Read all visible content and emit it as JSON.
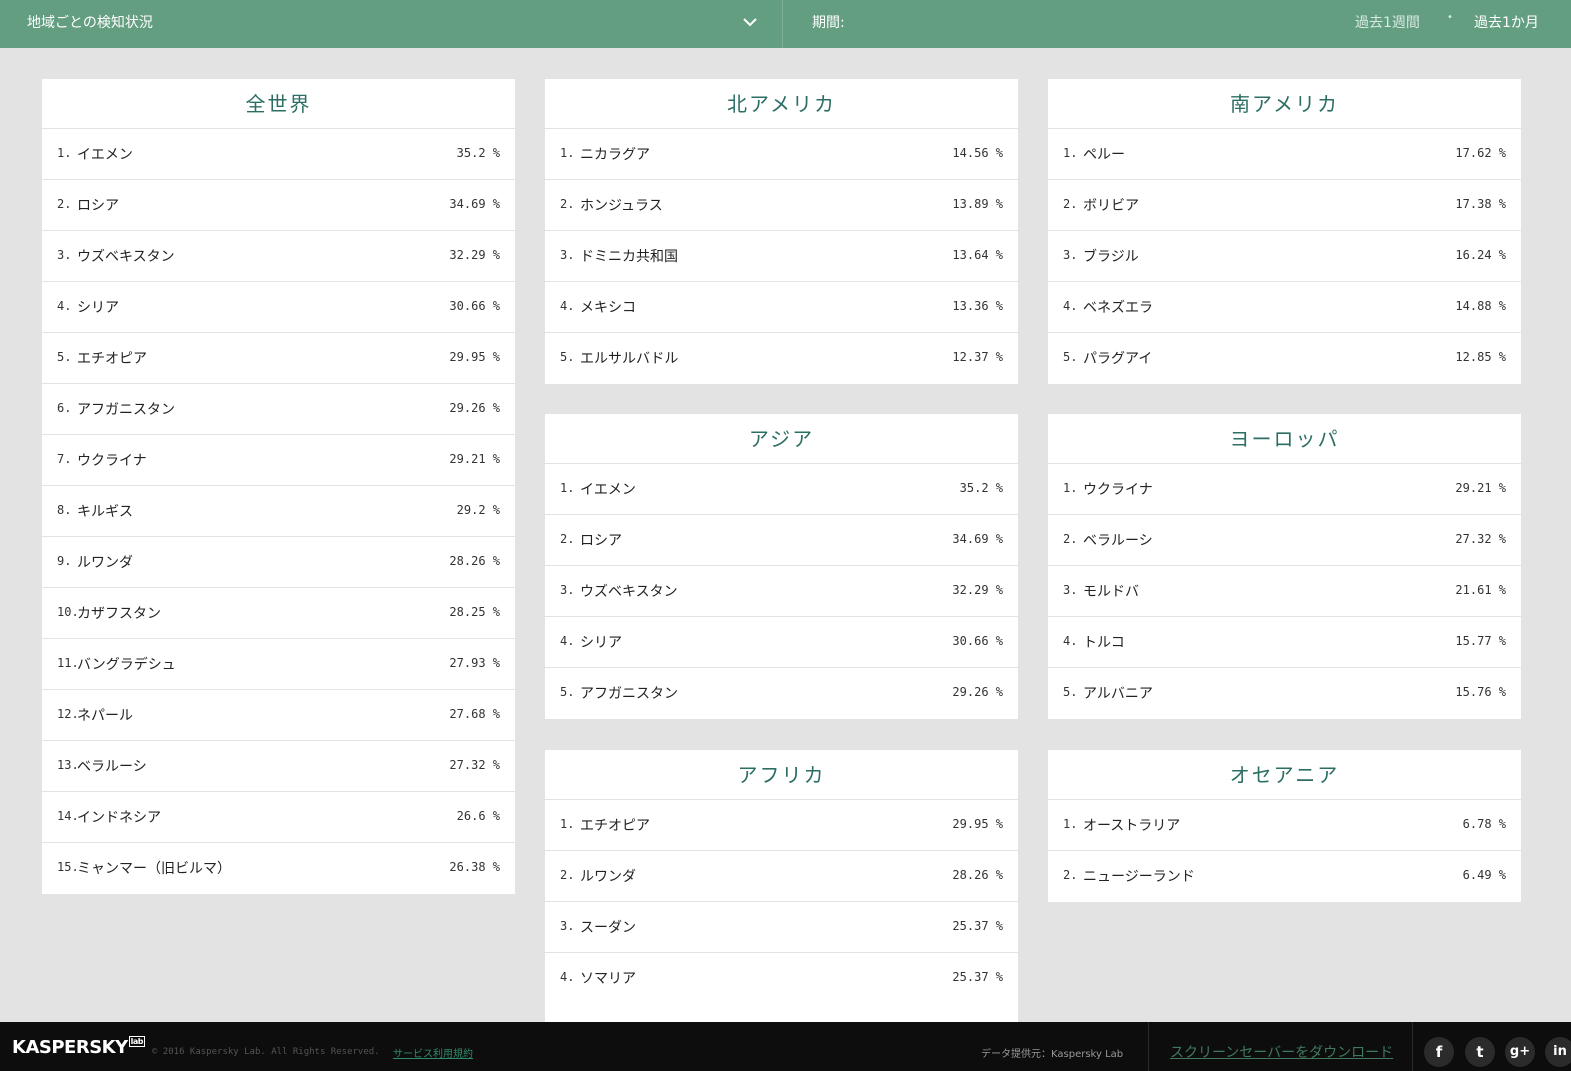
{
  "header": {
    "region_label": "地域ごとの検知状況",
    "period_label": "期間:",
    "period_week": "過去1週間",
    "period_dot": "•",
    "period_month": "過去1か月"
  },
  "cards": {
    "world": {
      "title": "全世界",
      "rows": [
        {
          "rank": "1.",
          "name": "イエメン",
          "pct": "35.2 %"
        },
        {
          "rank": "2.",
          "name": "ロシア",
          "pct": "34.69 %"
        },
        {
          "rank": "3.",
          "name": "ウズベキスタン",
          "pct": "32.29 %"
        },
        {
          "rank": "4.",
          "name": "シリア",
          "pct": "30.66 %"
        },
        {
          "rank": "5.",
          "name": "エチオピア",
          "pct": "29.95 %"
        },
        {
          "rank": "6.",
          "name": "アフガニスタン",
          "pct": "29.26 %"
        },
        {
          "rank": "7.",
          "name": "ウクライナ",
          "pct": "29.21 %"
        },
        {
          "rank": "8.",
          "name": "キルギス",
          "pct": "29.2 %"
        },
        {
          "rank": "9.",
          "name": "ルワンダ",
          "pct": "28.26 %"
        },
        {
          "rank": "10.",
          "name": "カザフスタン",
          "pct": "28.25 %"
        },
        {
          "rank": "11.",
          "name": "バングラデシュ",
          "pct": "27.93 %"
        },
        {
          "rank": "12.",
          "name": "ネパール",
          "pct": "27.68 %"
        },
        {
          "rank": "13.",
          "name": "ベラルーシ",
          "pct": "27.32 %"
        },
        {
          "rank": "14.",
          "name": "インドネシア",
          "pct": "26.6 %"
        },
        {
          "rank": "15.",
          "name": "ミャンマー（旧ビルマ）",
          "pct": "26.38 %"
        }
      ]
    },
    "north_america": {
      "title": "北アメリカ",
      "rows": [
        {
          "rank": "1.",
          "name": "ニカラグア",
          "pct": "14.56 %"
        },
        {
          "rank": "2.",
          "name": "ホンジュラス",
          "pct": "13.89 %"
        },
        {
          "rank": "3.",
          "name": "ドミニカ共和国",
          "pct": "13.64 %"
        },
        {
          "rank": "4.",
          "name": "メキシコ",
          "pct": "13.36 %"
        },
        {
          "rank": "5.",
          "name": "エルサルバドル",
          "pct": "12.37 %"
        }
      ]
    },
    "south_america": {
      "title": "南アメリカ",
      "rows": [
        {
          "rank": "1.",
          "name": "ペルー",
          "pct": "17.62 %"
        },
        {
          "rank": "2.",
          "name": "ボリビア",
          "pct": "17.38 %"
        },
        {
          "rank": "3.",
          "name": "ブラジル",
          "pct": "16.24 %"
        },
        {
          "rank": "4.",
          "name": "ベネズエラ",
          "pct": "14.88 %"
        },
        {
          "rank": "5.",
          "name": "パラグアイ",
          "pct": "12.85 %"
        }
      ]
    },
    "asia": {
      "title": "アジア",
      "rows": [
        {
          "rank": "1.",
          "name": "イエメン",
          "pct": "35.2 %"
        },
        {
          "rank": "2.",
          "name": "ロシア",
          "pct": "34.69 %"
        },
        {
          "rank": "3.",
          "name": "ウズベキスタン",
          "pct": "32.29 %"
        },
        {
          "rank": "4.",
          "name": "シリア",
          "pct": "30.66 %"
        },
        {
          "rank": "5.",
          "name": "アフガニスタン",
          "pct": "29.26 %"
        }
      ]
    },
    "europe": {
      "title": "ヨーロッパ",
      "rows": [
        {
          "rank": "1.",
          "name": "ウクライナ",
          "pct": "29.21 %"
        },
        {
          "rank": "2.",
          "name": "ベラルーシ",
          "pct": "27.32 %"
        },
        {
          "rank": "3.",
          "name": "モルドバ",
          "pct": "21.61 %"
        },
        {
          "rank": "4.",
          "name": "トルコ",
          "pct": "15.77 %"
        },
        {
          "rank": "5.",
          "name": "アルバニア",
          "pct": "15.76 %"
        }
      ]
    },
    "africa": {
      "title": "アフリカ",
      "rows": [
        {
          "rank": "1.",
          "name": "エチオピア",
          "pct": "29.95 %"
        },
        {
          "rank": "2.",
          "name": "ルワンダ",
          "pct": "28.26 %"
        },
        {
          "rank": "3.",
          "name": "スーダン",
          "pct": "25.37 %"
        },
        {
          "rank": "4.",
          "name": "ソマリア",
          "pct": "25.37 %"
        }
      ]
    },
    "oceania": {
      "title": "オセアニア",
      "rows": [
        {
          "rank": "1.",
          "name": "オーストラリア",
          "pct": "6.78 %"
        },
        {
          "rank": "2.",
          "name": "ニュージーランド",
          "pct": "6.49 %"
        }
      ]
    }
  },
  "footer": {
    "logo": "KASPERSKY",
    "logo_badge": "lab",
    "copyright": "© 2016 Kaspersky Lab. All Rights Reserved.",
    "terms": "サービス利用規約",
    "source": "データ提供元：Kaspersky Lab",
    "screensaver": "スクリーンセーバーをダウンロード",
    "social": [
      {
        "icon": "facebook-icon",
        "glyph": "f"
      },
      {
        "icon": "twitter-icon",
        "glyph": "t"
      },
      {
        "icon": "google-plus-icon",
        "glyph": "g+"
      },
      {
        "icon": "linkedin-icon",
        "glyph": "in"
      }
    ]
  }
}
